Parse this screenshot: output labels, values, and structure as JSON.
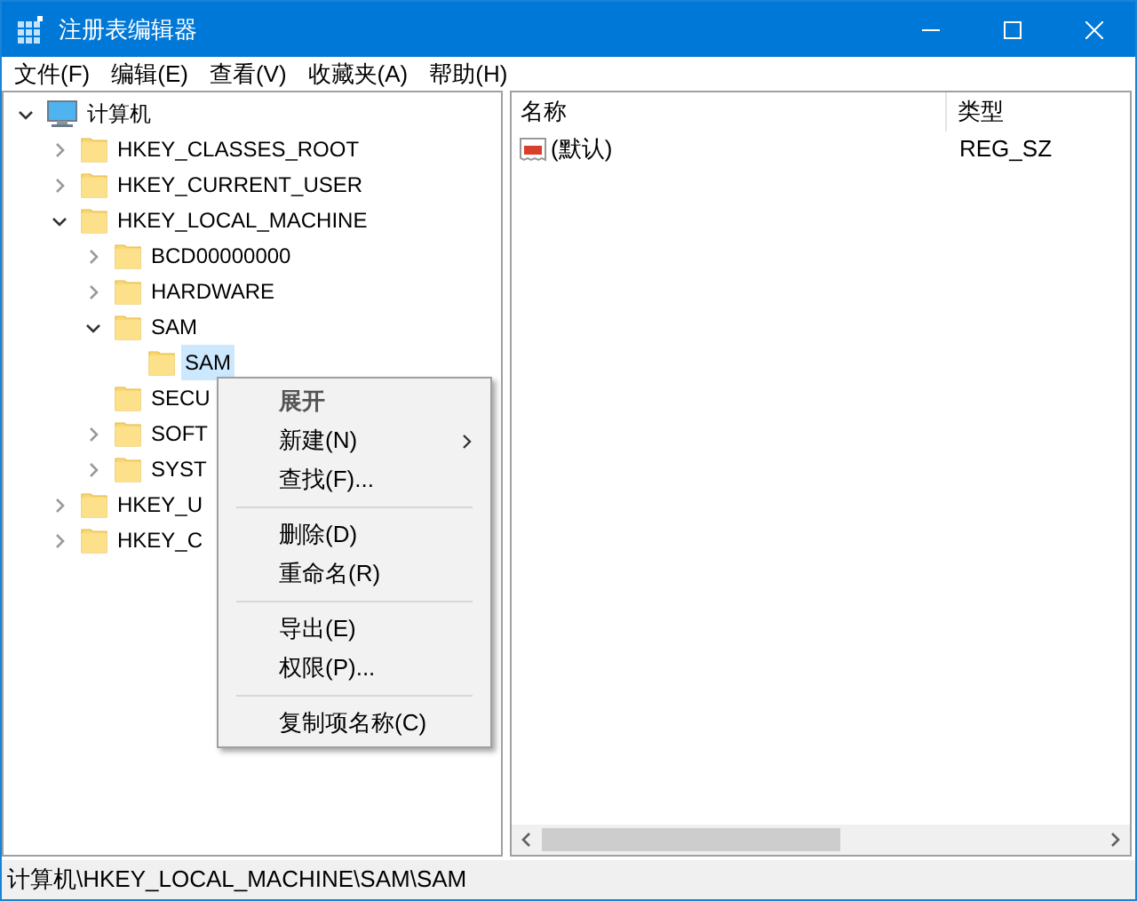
{
  "window": {
    "title": "注册表编辑器"
  },
  "menu_bar": [
    "文件(F)",
    "编辑(E)",
    "查看(V)",
    "收藏夹(A)",
    "帮助(H)"
  ],
  "tree": [
    {
      "label": "计算机",
      "kind": "computer",
      "expanded": true,
      "selected": false,
      "children": [
        {
          "label": "HKEY_CLASSES_ROOT",
          "kind": "folder",
          "expanded": false,
          "selected": false
        },
        {
          "label": "HKEY_CURRENT_USER",
          "kind": "folder",
          "expanded": false,
          "selected": false
        },
        {
          "label": "HKEY_LOCAL_MACHINE",
          "kind": "folder",
          "expanded": true,
          "selected": false,
          "children": [
            {
              "label": "BCD00000000",
              "kind": "folder",
              "expanded": false,
              "selected": false
            },
            {
              "label": "HARDWARE",
              "kind": "folder",
              "expanded": false,
              "selected": false
            },
            {
              "label": "SAM",
              "kind": "folder",
              "expanded": true,
              "selected": false,
              "children": [
                {
                  "label": "SAM",
                  "kind": "folder",
                  "selected": true
                }
              ]
            },
            {
              "label": "SECU",
              "kind": "folder",
              "selected": false
            },
            {
              "label": "SOFT",
              "kind": "folder",
              "expanded": false,
              "selected": false
            },
            {
              "label": "SYST",
              "kind": "folder",
              "expanded": false,
              "selected": false
            }
          ]
        },
        {
          "label": "HKEY_U",
          "kind": "folder",
          "expanded": false,
          "selected": false
        },
        {
          "label": "HKEY_C",
          "kind": "folder",
          "expanded": false,
          "selected": false
        }
      ]
    }
  ],
  "values_table": {
    "columns": [
      "名称",
      "类型"
    ],
    "rows": [
      {
        "name": "(默认)",
        "type": "REG_SZ"
      }
    ]
  },
  "context_menu": [
    {
      "kind": "item",
      "label": "展开",
      "default": true,
      "submenu": false
    },
    {
      "kind": "item",
      "label": "新建(N)",
      "default": false,
      "submenu": true
    },
    {
      "kind": "item",
      "label": "查找(F)...",
      "default": false,
      "submenu": false
    },
    {
      "kind": "separator"
    },
    {
      "kind": "item",
      "label": "删除(D)",
      "default": false,
      "submenu": false
    },
    {
      "kind": "item",
      "label": "重命名(R)",
      "default": false,
      "submenu": false
    },
    {
      "kind": "separator"
    },
    {
      "kind": "item",
      "label": "导出(E)",
      "default": false,
      "submenu": false
    },
    {
      "kind": "item",
      "label": "权限(P)...",
      "default": false,
      "submenu": false
    },
    {
      "kind": "separator"
    },
    {
      "kind": "item",
      "label": "复制项名称(C)",
      "default": false,
      "submenu": false
    }
  ],
  "status_bar": "计算机\\HKEY_LOCAL_MACHINE\\SAM\\SAM"
}
